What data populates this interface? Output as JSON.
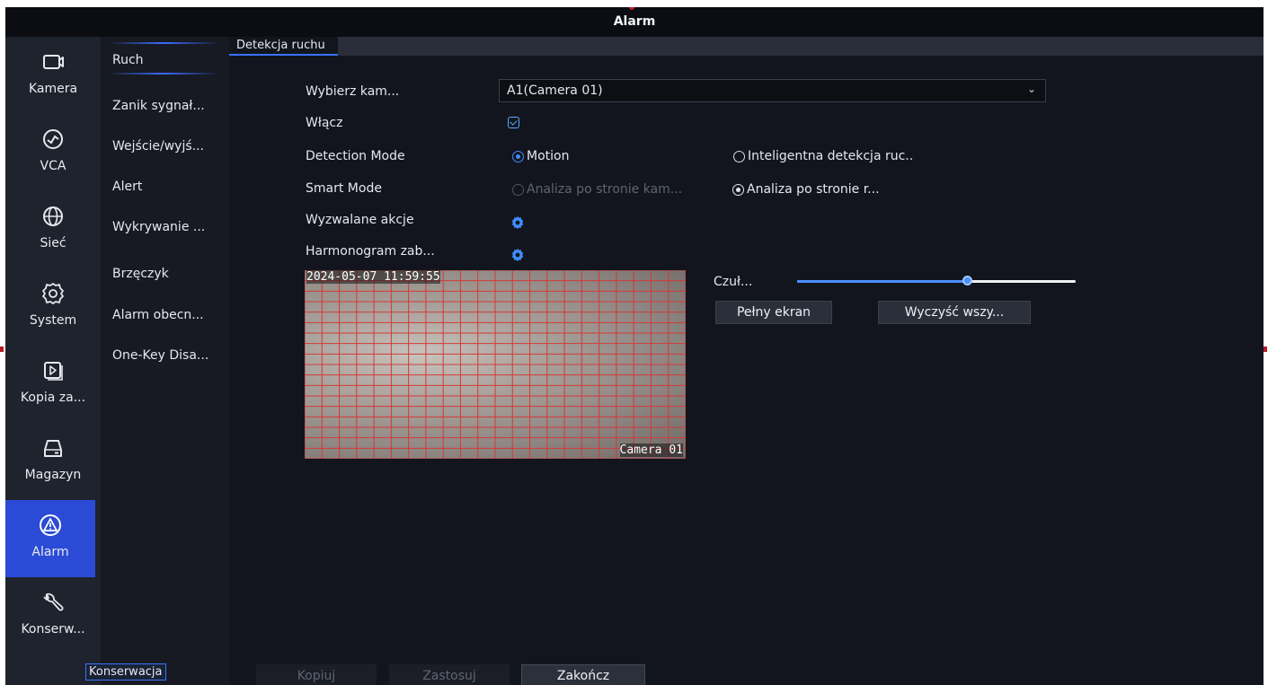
{
  "window": {
    "title": "Alarm"
  },
  "nav": {
    "items": [
      {
        "label": "Kamera",
        "icon": "camera-icon"
      },
      {
        "label": "VCA",
        "icon": "vca-icon"
      },
      {
        "label": "Sieć",
        "icon": "globe-icon"
      },
      {
        "label": "System",
        "icon": "gear-icon"
      },
      {
        "label": "Kopia za...",
        "icon": "play-icon"
      },
      {
        "label": "Magazyn",
        "icon": "hdd-icon"
      },
      {
        "label": "Alarm",
        "icon": "warning-icon",
        "active": true
      },
      {
        "label": "Konserw...",
        "icon": "wrench-icon"
      }
    ]
  },
  "submenu": {
    "items": [
      {
        "label": "Ruch",
        "active": true
      },
      {
        "label": "Zanik sygnał..."
      },
      {
        "label": "Wejście/wyjś..."
      },
      {
        "label": "Alert"
      },
      {
        "label": "Wykrywanie ..."
      },
      {
        "label": "Brzęczyk"
      },
      {
        "label": "Alarm obecn..."
      },
      {
        "label": "One-Key Disa..."
      }
    ]
  },
  "tab": {
    "label": "Detekcja ruchu"
  },
  "form": {
    "camera_label": "Wybierz kam...",
    "camera_value": "A1(Camera 01)",
    "enable_label": "Włącz",
    "enable_checked": true,
    "detection_mode_label": "Detection Mode",
    "detection_mode_options": [
      "Motion",
      "Inteligentna detekcja ruc.."
    ],
    "detection_mode_selected": "Motion",
    "smart_mode_label": "Smart Mode",
    "smart_mode_options": [
      "Analiza po stronie kam...",
      "Analiza po stronie r..."
    ],
    "smart_mode_selected": "Analiza po stronie r...",
    "actions_label": "Wyzwalane akcje",
    "schedule_label": "Harmonogram zab..."
  },
  "preview": {
    "timestamp": "2024-05-07 11:59:55",
    "camera_name": "Camera 01"
  },
  "sensitivity": {
    "label": "Czuł...",
    "value_fraction": 0.61
  },
  "buttons": {
    "fullscreen": "Pełny ekran",
    "clear_all": "Wyczyść wszy...",
    "copy": "Kopiuj",
    "apply": "Zastosuj",
    "exit": "Zakończ"
  },
  "tooltip": "Konserwacja",
  "colors": {
    "accent": "#3a72ff",
    "grid": "#d23a3a",
    "background": "#12151d"
  }
}
